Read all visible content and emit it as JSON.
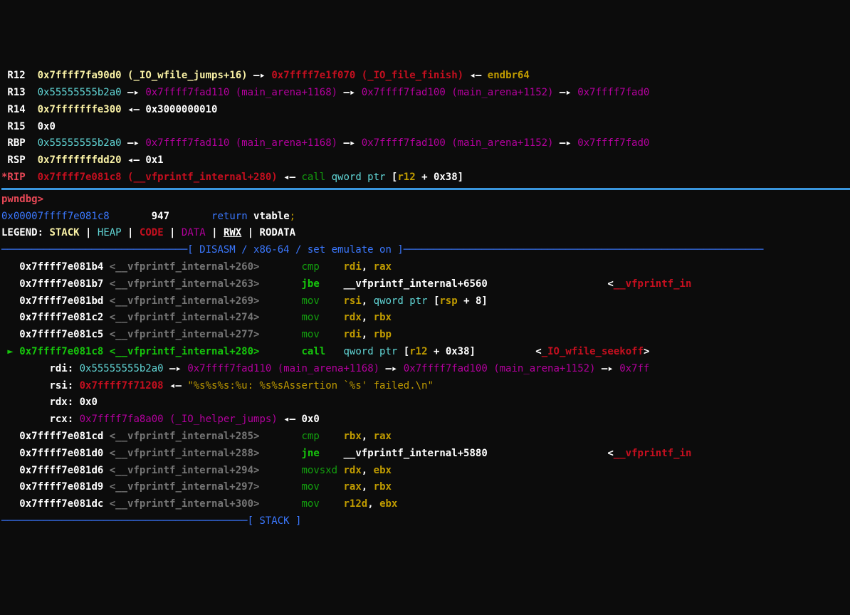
{
  "regs": [
    {
      "name": "R12",
      "val": "0x7ffff7fa90d0",
      "sym": "(_IO_wfile_jumps+16)",
      "p1": "0x7ffff7e1f070",
      "p1s": "(_IO_file_finish)",
      "tail": "endbr64"
    },
    {
      "name": "R13",
      "val": "0x55555555b2a0",
      "p1": "0x7ffff7fad110",
      "p1s": "(main_arena+1168)",
      "p2": "0x7ffff7fad100",
      "p2s": "(main_arena+1152)",
      "p3": "0x7ffff7fad0"
    },
    {
      "name": "R14",
      "val": "0x7fffffffe300",
      "tail": "0x3000000010"
    },
    {
      "name": "R15",
      "val": "0x0"
    },
    {
      "name": "RBP",
      "val": "0x55555555b2a0",
      "p1": "0x7ffff7fad110",
      "p1s": "(main_arena+1168)",
      "p2": "0x7ffff7fad100",
      "p2s": "(main_arena+1152)",
      "p3": "0x7ffff7fad0"
    },
    {
      "name": "RSP",
      "val": "0x7fffffffdd20",
      "tail": "0x1"
    }
  ],
  "rip": {
    "label": "*RIP",
    "val": "0x7ffff7e081c8",
    "sym": "(__vfprintf_internal+280)",
    "tail": "call qword ptr [r12 + 0x38]"
  },
  "prompt": "pwndbg> ",
  "srcline": {
    "addr": "0x00007ffff7e081c8",
    "lineno": "947",
    "kw": "return",
    "var": "vtable",
    ";": ";"
  },
  "legend": {
    "label": "LEGEND:",
    "stack": "STACK",
    "heap": "HEAP",
    "code": "CODE",
    "data": "DATA",
    "rwx": "RWX",
    "rodata": "RODATA",
    "sep": " | "
  },
  "disasm_header": "[ DISASM / x86-64 / set emulate on ]",
  "disasm": [
    {
      "addr": "0x7ffff7e081b4",
      "sym": "__vfprintf_internal+260",
      "mn": "cmp",
      "ops": [
        "rdi",
        ", ",
        "rax"
      ]
    },
    {
      "addr": "0x7ffff7e081b7",
      "sym": "__vfprintf_internal+263",
      "mn": "jbe",
      "tgt": "__vfprintf_internal+6560",
      "jref": "__vfprintf_in"
    },
    {
      "blank": true
    },
    {
      "addr": "0x7ffff7e081bd",
      "sym": "__vfprintf_internal+269",
      "mn": "mov",
      "ops": [
        "rsi",
        ", ",
        "qword ptr ",
        "[",
        "rsp",
        " + ",
        "8",
        "]"
      ]
    },
    {
      "addr": "0x7ffff7e081c2",
      "sym": "__vfprintf_internal+274",
      "mn": "mov",
      "ops": [
        "rdx",
        ", ",
        "rbx"
      ]
    },
    {
      "addr": "0x7ffff7e081c5",
      "sym": "__vfprintf_internal+277",
      "mn": "mov",
      "ops": [
        "rdi",
        ", ",
        "rbp"
      ]
    },
    {
      "addr": "0x7ffff7e081c8",
      "sym": "__vfprintf_internal+280",
      "mn": "call",
      "ops": [
        "qword ptr ",
        "[",
        "r12",
        " + ",
        "0x38",
        "]"
      ],
      "cref": "_IO_wfile_seekoff",
      "cur": true
    },
    {
      "arg": "rdi",
      "av": "0x55555555b2a0",
      "chain": [
        {
          "t": "arrow"
        },
        {
          "v": "0x7ffff7fad110",
          "s": "(main_arena+1168)"
        },
        {
          "t": "arrow"
        },
        {
          "v": "0x7ffff7fad100",
          "s": "(main_arena+1152)"
        },
        {
          "t": "arrow"
        },
        {
          "v": "0x7ff"
        }
      ]
    },
    {
      "arg": "rsi",
      "av": "0x7ffff7f71208",
      "str": "\"%s%s%s:%u: %s%sAssertion `%s' failed.\\n\""
    },
    {
      "arg": "rdx",
      "av": "0x0"
    },
    {
      "arg": "rcx",
      "av": "0x7ffff7fa8a00",
      "asym": "(_IO_helper_jumps)",
      "deref": "0x0"
    },
    {
      "blank": true
    },
    {
      "addr": "0x7ffff7e081cd",
      "sym": "__vfprintf_internal+285",
      "mn": "cmp",
      "ops": [
        "rbx",
        ", ",
        "rax"
      ]
    },
    {
      "addr": "0x7ffff7e081d0",
      "sym": "__vfprintf_internal+288",
      "mn": "jne",
      "tgt": "__vfprintf_internal+5880",
      "jref": "__vfprintf_in"
    },
    {
      "blank": true
    },
    {
      "addr": "0x7ffff7e081d6",
      "sym": "__vfprintf_internal+294",
      "mn": "movsxd",
      "ops": [
        "rdx",
        ", ",
        "ebx"
      ]
    },
    {
      "addr": "0x7ffff7e081d9",
      "sym": "__vfprintf_internal+297",
      "mn": "mov",
      "ops": [
        "rax",
        ", ",
        "rbx"
      ]
    },
    {
      "addr": "0x7ffff7e081dc",
      "sym": "__vfprintf_internal+300",
      "mn": "mov",
      "ops": [
        "r12d",
        ", ",
        "ebx"
      ]
    }
  ],
  "stack_header": "[ STACK ]",
  "colors": {
    "stack": "#f9f1a5",
    "heap": "#61d6d6"
  }
}
